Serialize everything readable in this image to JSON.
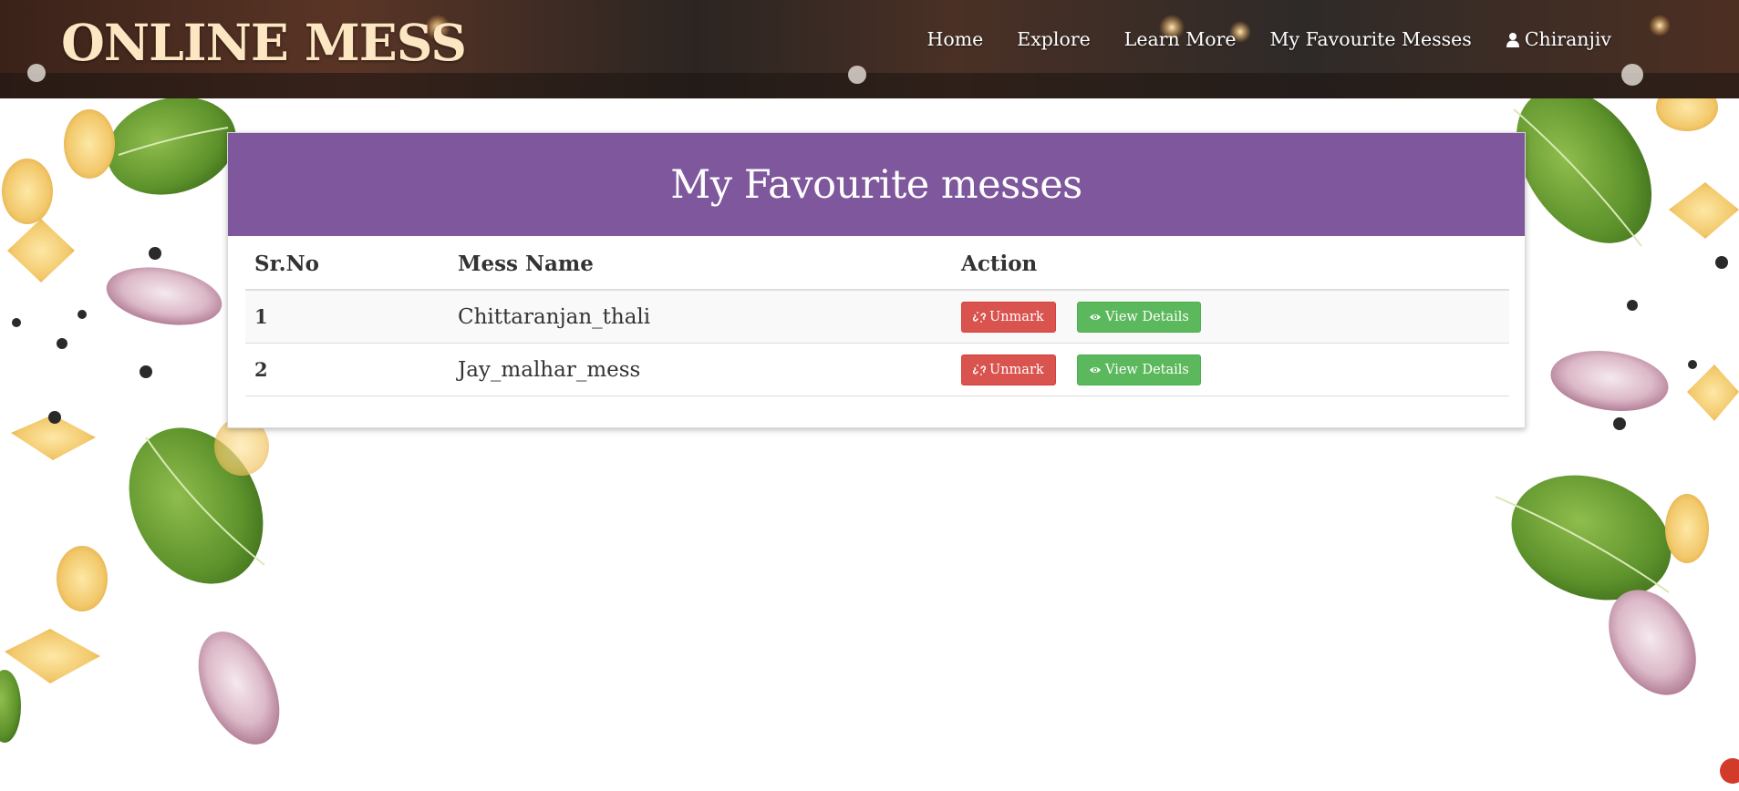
{
  "header": {
    "brand": "ONLINE MESS",
    "nav": [
      {
        "label": "Home"
      },
      {
        "label": "Explore"
      },
      {
        "label": "Learn More"
      },
      {
        "label": "My Favourite Messes"
      }
    ],
    "user": {
      "label": "Chiranjiv",
      "icon": "user-icon"
    }
  },
  "panel": {
    "title": "My Favourite messes",
    "color": "#7f579c",
    "columns": [
      "Sr.No",
      "Mess Name",
      "Action"
    ],
    "rows": [
      {
        "sr": "1",
        "name": "Chittaranjan_thali",
        "unmark": "Unmark",
        "view": "View Details"
      },
      {
        "sr": "2",
        "name": "Jay_malhar_mess",
        "unmark": "Unmark",
        "view": "View Details"
      }
    ]
  },
  "buttons": {
    "unmark_icon": "unlink-icon",
    "view_icon": "eye-icon",
    "unmark_color": "#d9534f",
    "view_color": "#5cb85c"
  }
}
